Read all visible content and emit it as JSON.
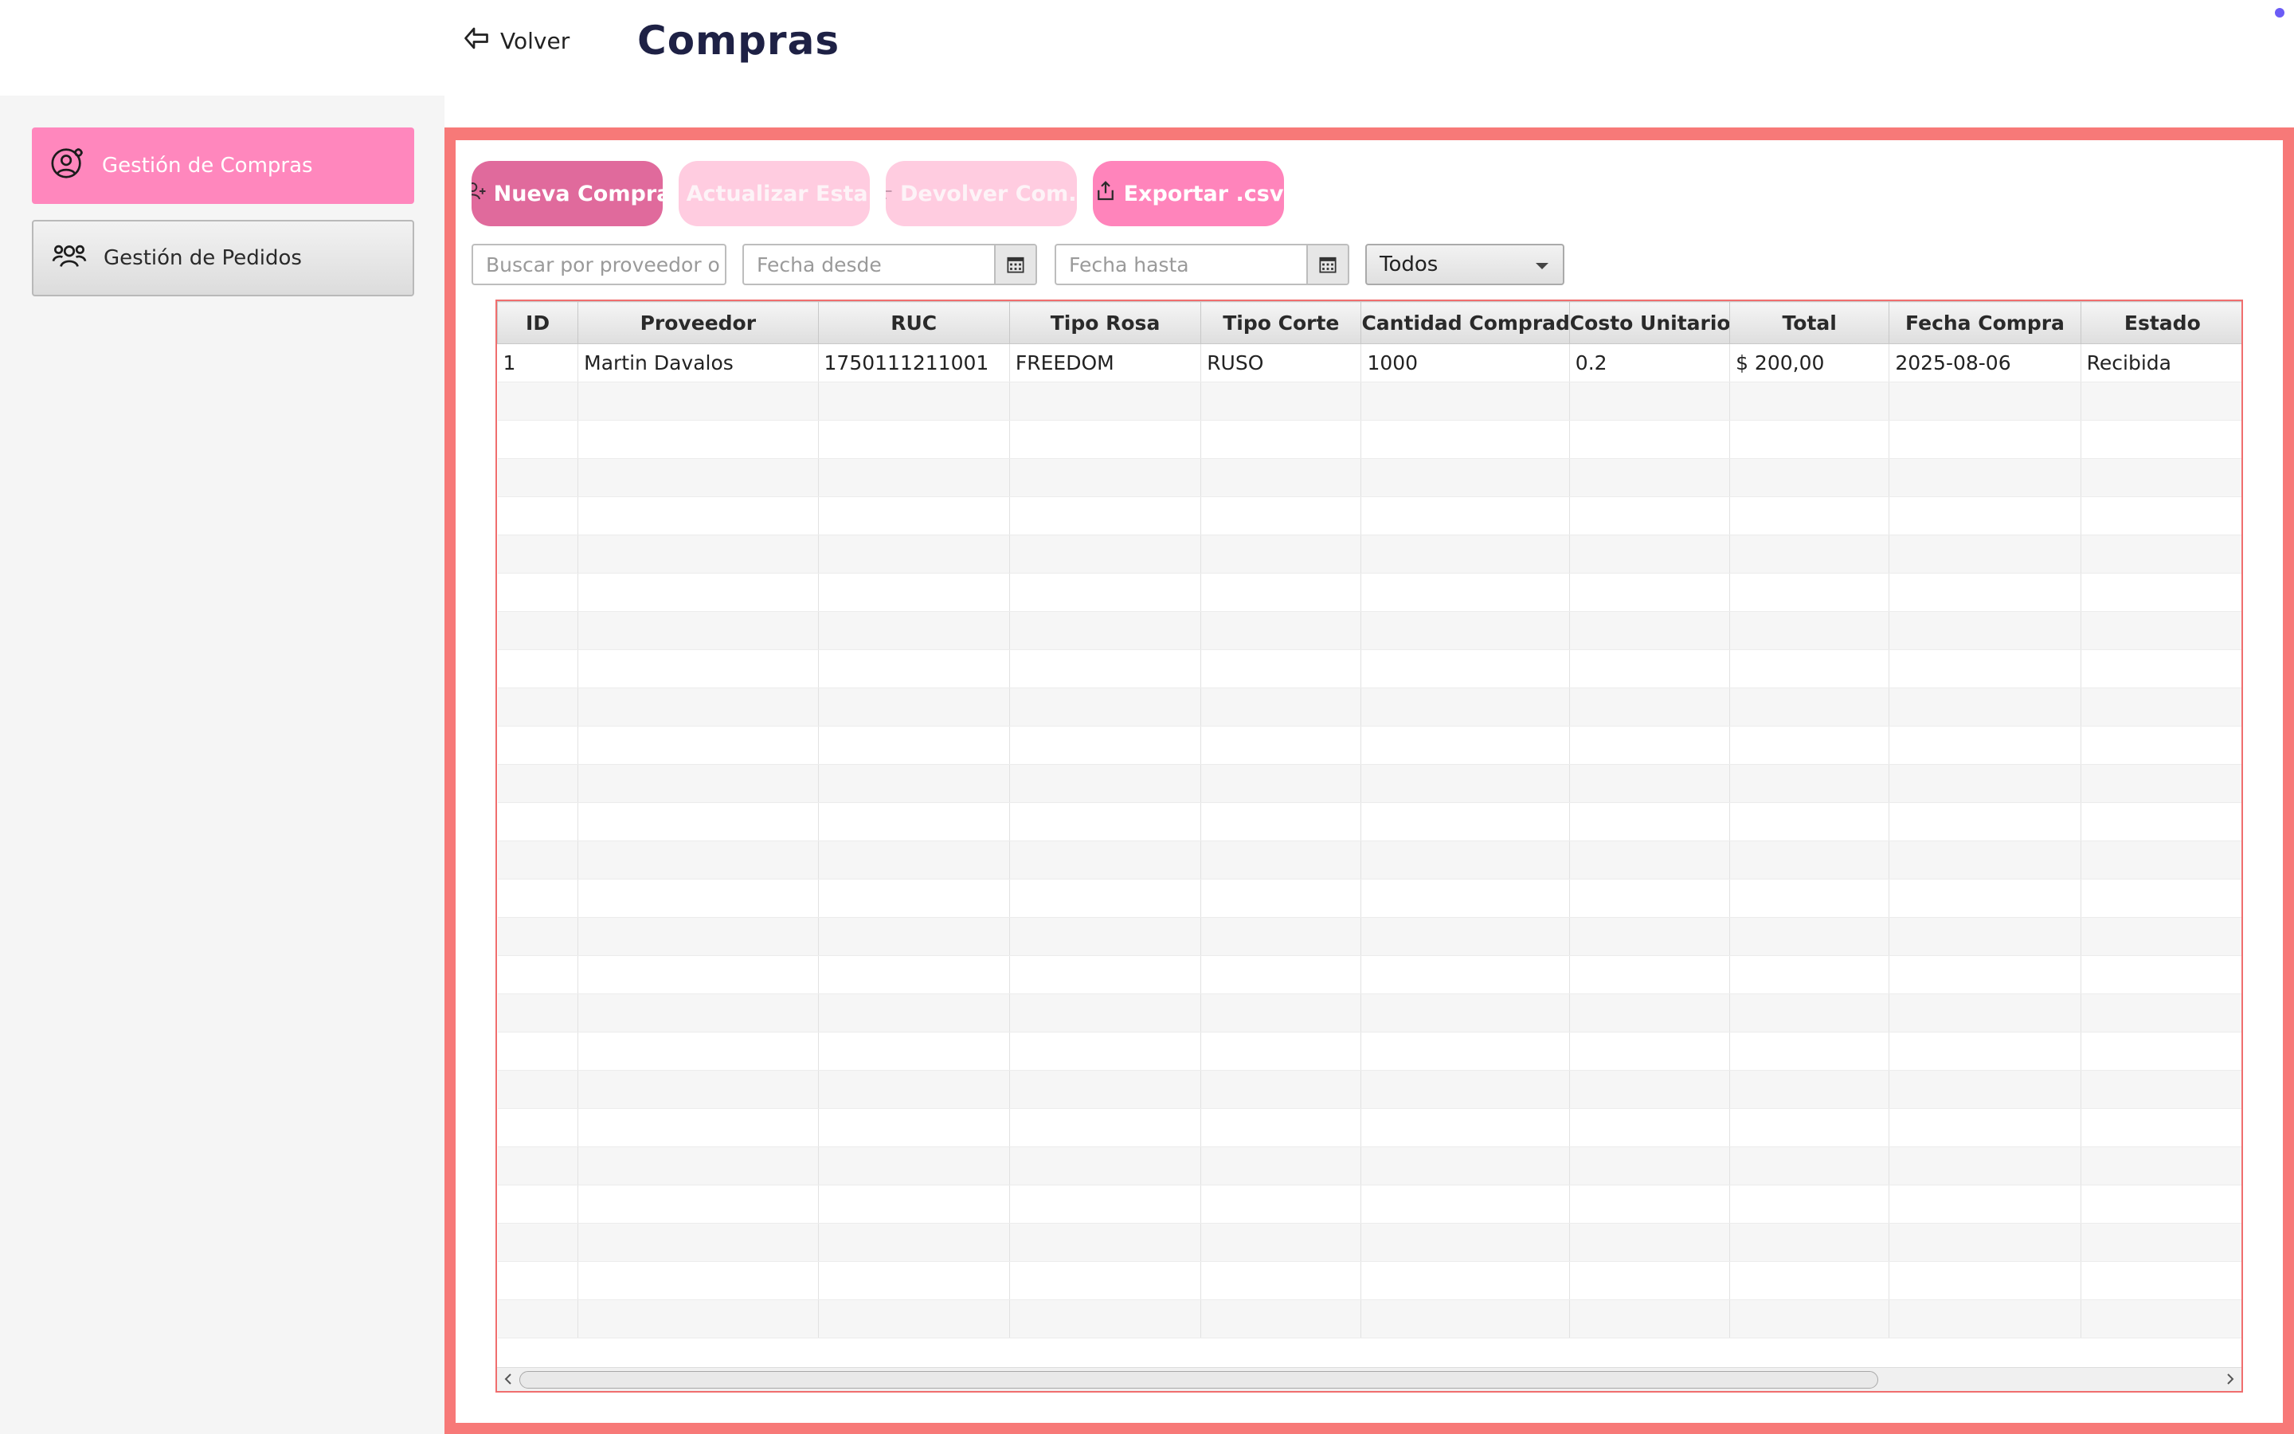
{
  "header": {
    "back_label": "Volver",
    "title": "Compras"
  },
  "sidebar": {
    "items": [
      {
        "label": "Gestión de Compras",
        "icon": "user-settings-icon",
        "active": true
      },
      {
        "label": "Gestión de Pedidos",
        "icon": "users-group-icon",
        "active": false
      }
    ]
  },
  "toolbar": {
    "nueva_compra": "Nueva Compra",
    "actualizar_estado": "Actualizar Esta...",
    "devolver_compra": "Devolver Com...",
    "exportar_csv": "Exportar .csv"
  },
  "filters": {
    "search_placeholder": "Buscar por proveedor o tip",
    "fecha_desde_placeholder": "Fecha desde",
    "fecha_hasta_placeholder": "Fecha hasta",
    "estado_selected": "Todos"
  },
  "table": {
    "columns": [
      "ID",
      "Proveedor",
      "RUC",
      "Tipo Rosa",
      "Tipo Corte",
      "Cantidad Comprada",
      "Costo Unitario",
      "Total",
      "Fecha Compra",
      "Estado"
    ],
    "rows": [
      [
        "1",
        "Martin Davalos",
        "1750111211001",
        "FREEDOM",
        "RUSO",
        "1000",
        "0.2",
        "$ 200,00",
        "2025-08-06",
        "Recibida"
      ]
    ]
  },
  "colors": {
    "accent_pink": "#ff87bd",
    "primary_button": "#e06a9c",
    "frame_red": "#f77978",
    "title_navy": "#1e2145"
  }
}
